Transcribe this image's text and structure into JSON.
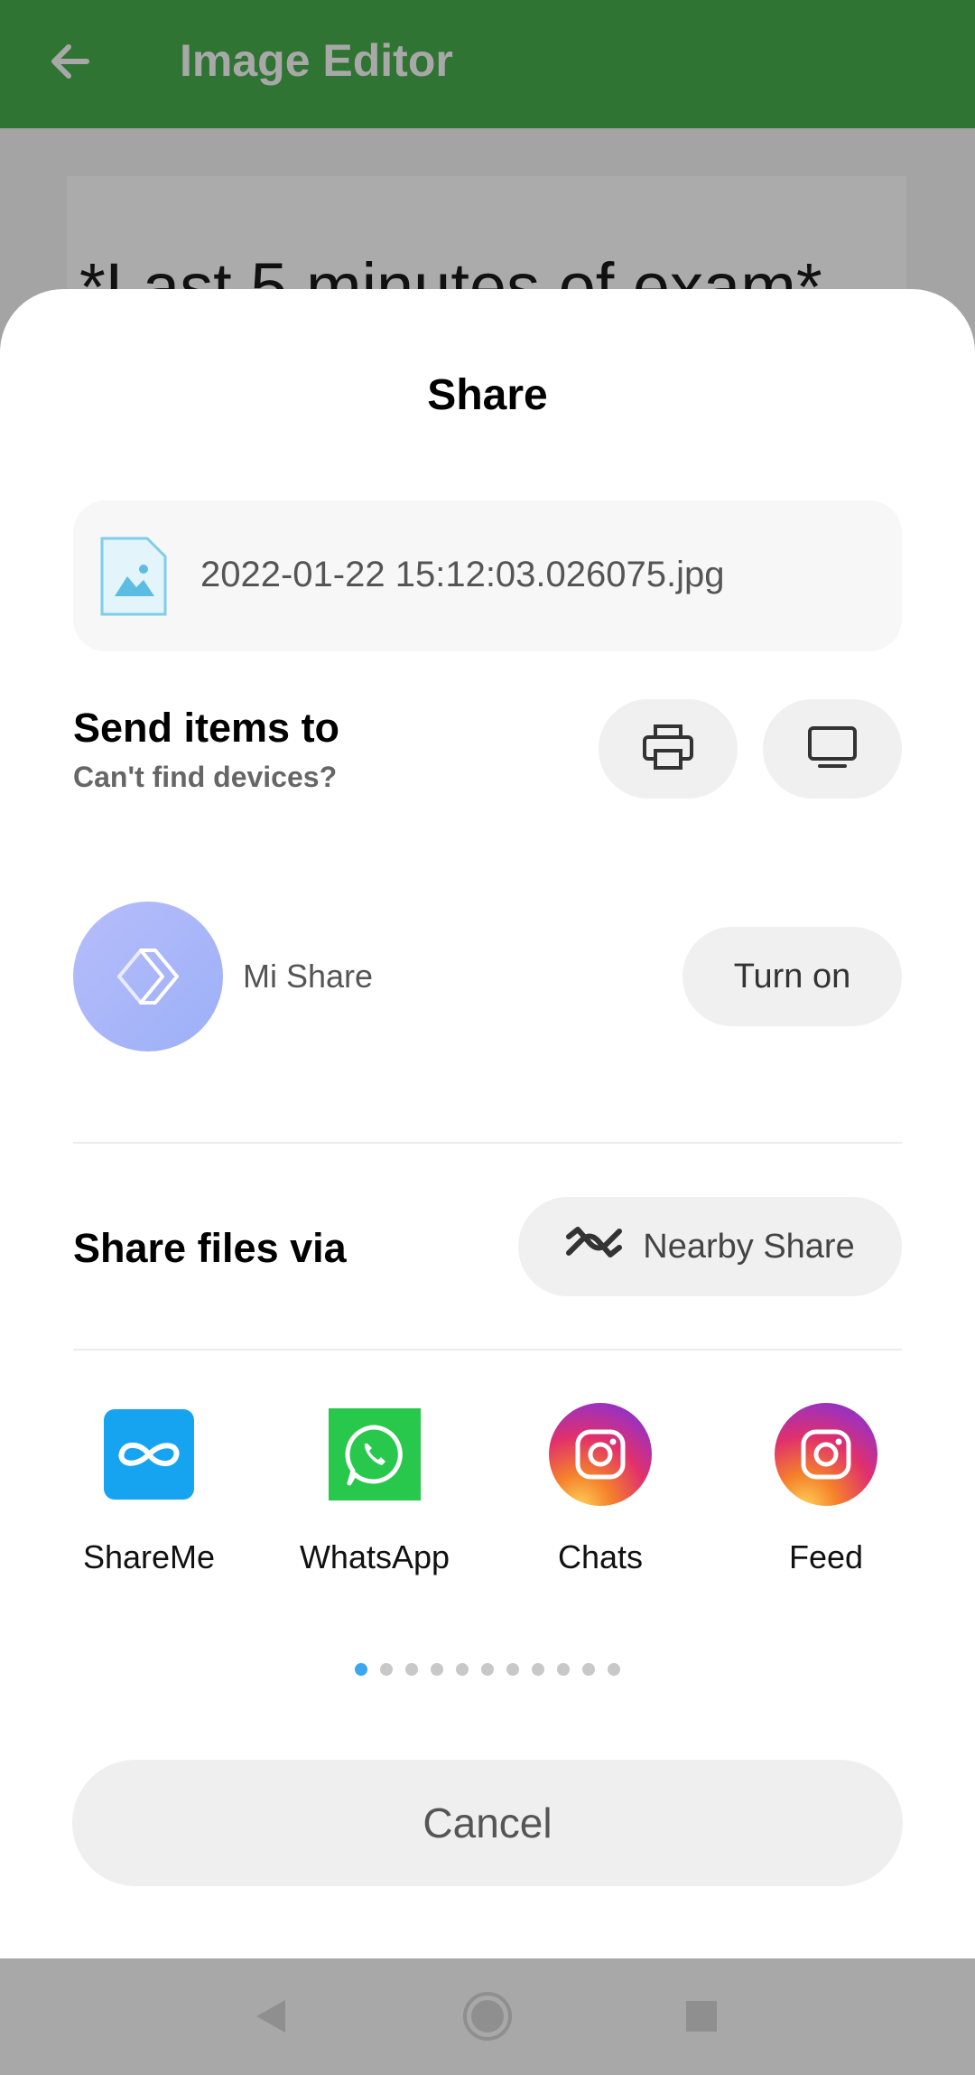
{
  "background_app": {
    "title": "Image Editor",
    "content_text": "*Last 5 minutes of exam*",
    "toolbar_color": "#2f7432"
  },
  "share_sheet": {
    "title": "Share",
    "file": {
      "name": "2022-01-22 15:12:03.026075.jpg",
      "icon": "image-file-icon"
    },
    "send_items": {
      "title": "Send items to",
      "subtitle": "Can't find devices?",
      "buttons": [
        {
          "icon": "printer-icon"
        },
        {
          "icon": "monitor-icon"
        }
      ]
    },
    "mi_share": {
      "label": "Mi Share",
      "button_label": "Turn on"
    },
    "share_via": {
      "title": "Share files via",
      "nearby_label": "Nearby Share"
    },
    "apps": [
      {
        "label": "ShareMe",
        "icon": "shareme-icon"
      },
      {
        "label": "WhatsApp",
        "icon": "whatsapp-icon"
      },
      {
        "label": "Chats",
        "icon": "instagram-icon"
      },
      {
        "label": "Feed",
        "icon": "instagram-icon"
      }
    ],
    "pagination": {
      "current_page": 1,
      "total_pages": 11
    },
    "cancel_label": "Cancel",
    "accent_color": "#3ba6f2"
  },
  "nav_bar": {
    "buttons": [
      "back-icon",
      "home-icon",
      "recents-icon"
    ]
  }
}
